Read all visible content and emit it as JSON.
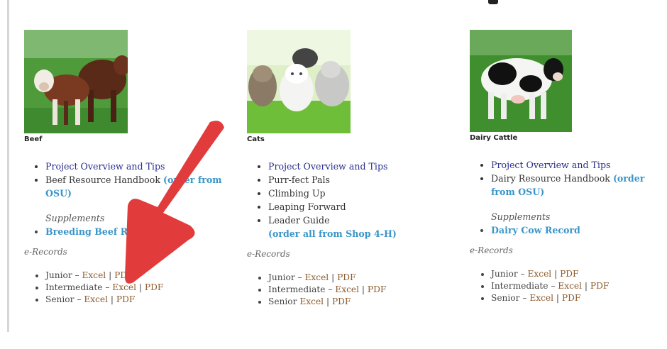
{
  "columns": [
    {
      "name": "Beef",
      "links": {
        "overview": "Project Overview and Tips",
        "handbook_text": "Beef Resource Handbook",
        "handbook_order": "(order from OSU)"
      },
      "supplements_label": "Supplements",
      "supplement_item": "Breeding Beef Record",
      "erecords_label": "e-Records",
      "records": [
        {
          "level": "Junior – ",
          "excel": "Excel",
          "sep": " | ",
          "pdf": "PDF"
        },
        {
          "level": "Intermediate – ",
          "excel": "Excel",
          "sep": " | ",
          "pdf": "PDF"
        },
        {
          "level": "Senior – ",
          "excel": "Excel",
          "sep": " | ",
          "pdf": "PDF"
        }
      ]
    },
    {
      "name": "Cats",
      "links": {
        "overview": "Project Overview and Tips",
        "item2": "Purr-fect Pals",
        "item3": "Climbing Up",
        "item4": "Leaping Forward",
        "item5": "Leader Guide",
        "order_all": "(order all from Shop 4-H)"
      },
      "erecords_label": "e-Records",
      "records": [
        {
          "level": "Junior – ",
          "excel": "Excel",
          "sep": " | ",
          "pdf": "PDF"
        },
        {
          "level": "Intermediate – ",
          "excel": "Excel",
          "sep": " | ",
          "pdf": "PDF"
        },
        {
          "level": "Senior ",
          "excel": "Excel",
          "sep": " | ",
          "pdf": "PDF"
        }
      ]
    },
    {
      "name": "Dairy Cattle",
      "links": {
        "overview": "Project Overview and Tips",
        "handbook_text": "Dairy Resource Handbook",
        "handbook_order": "(order from OSU)"
      },
      "supplements_label": "Supplements",
      "supplement_item": "Dairy Cow Record",
      "erecords_label": "e-Records",
      "records": [
        {
          "level": "Junior – ",
          "excel": "Excel",
          "sep": " | ",
          "pdf": "PDF"
        },
        {
          "level": "Intermediate – ",
          "excel": "Excel",
          "sep": " | ",
          "pdf": "PDF"
        },
        {
          "level": "Senior – ",
          "excel": "Excel",
          "sep": " | ",
          "pdf": "PDF"
        }
      ]
    }
  ],
  "colors": {
    "link_dark": "#2a2f8f",
    "link_light": "#3a95c8",
    "record_link": "#8b5a2b",
    "arrow": "#e23b3b"
  },
  "icons": {
    "arrow": "red-arrow-annotation-icon"
  }
}
